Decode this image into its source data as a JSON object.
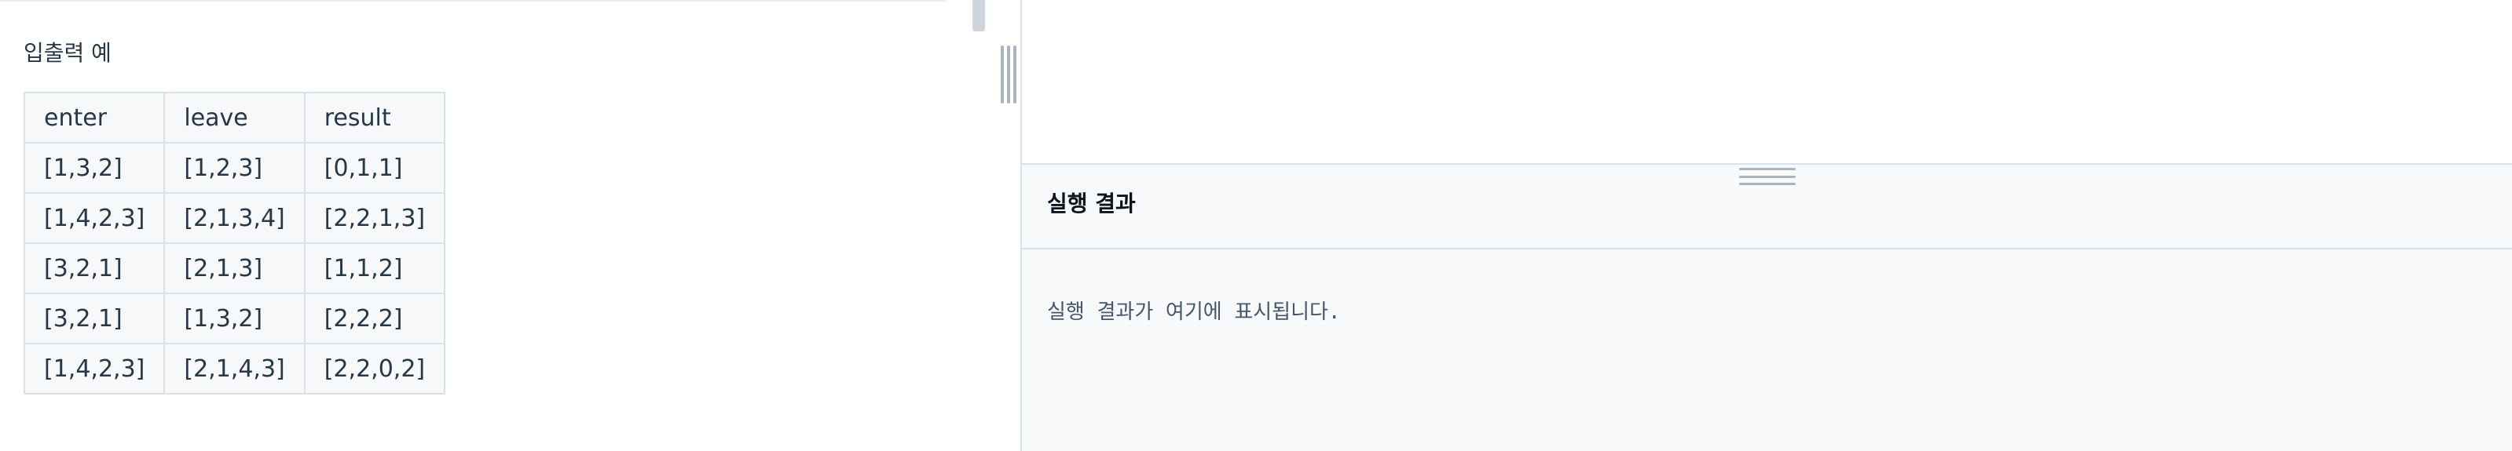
{
  "description_panel": {
    "io_example_heading": "입출력 예",
    "table": {
      "headers": [
        "enter",
        "leave",
        "result"
      ],
      "rows": [
        [
          "[1,3,2]",
          "[1,2,3]",
          "[0,1,1]"
        ],
        [
          "[1,4,2,3]",
          "[2,1,3,4]",
          "[2,2,1,3]"
        ],
        [
          "[3,2,1]",
          "[2,1,3]",
          "[1,1,2]"
        ],
        [
          "[3,2,1]",
          "[1,3,2]",
          "[2,2,2]"
        ],
        [
          "[1,4,2,3]",
          "[2,1,4,3]",
          "[2,2,0,2]"
        ]
      ]
    }
  },
  "result_panel": {
    "title": "실행 결과",
    "placeholder_output": "실행 결과가 여기에 표시됩니다."
  },
  "colors": {
    "border": "#d7e2eb",
    "text": "#263747",
    "panel_bg": "#f8f9fb",
    "grip": "#aab4bf"
  }
}
